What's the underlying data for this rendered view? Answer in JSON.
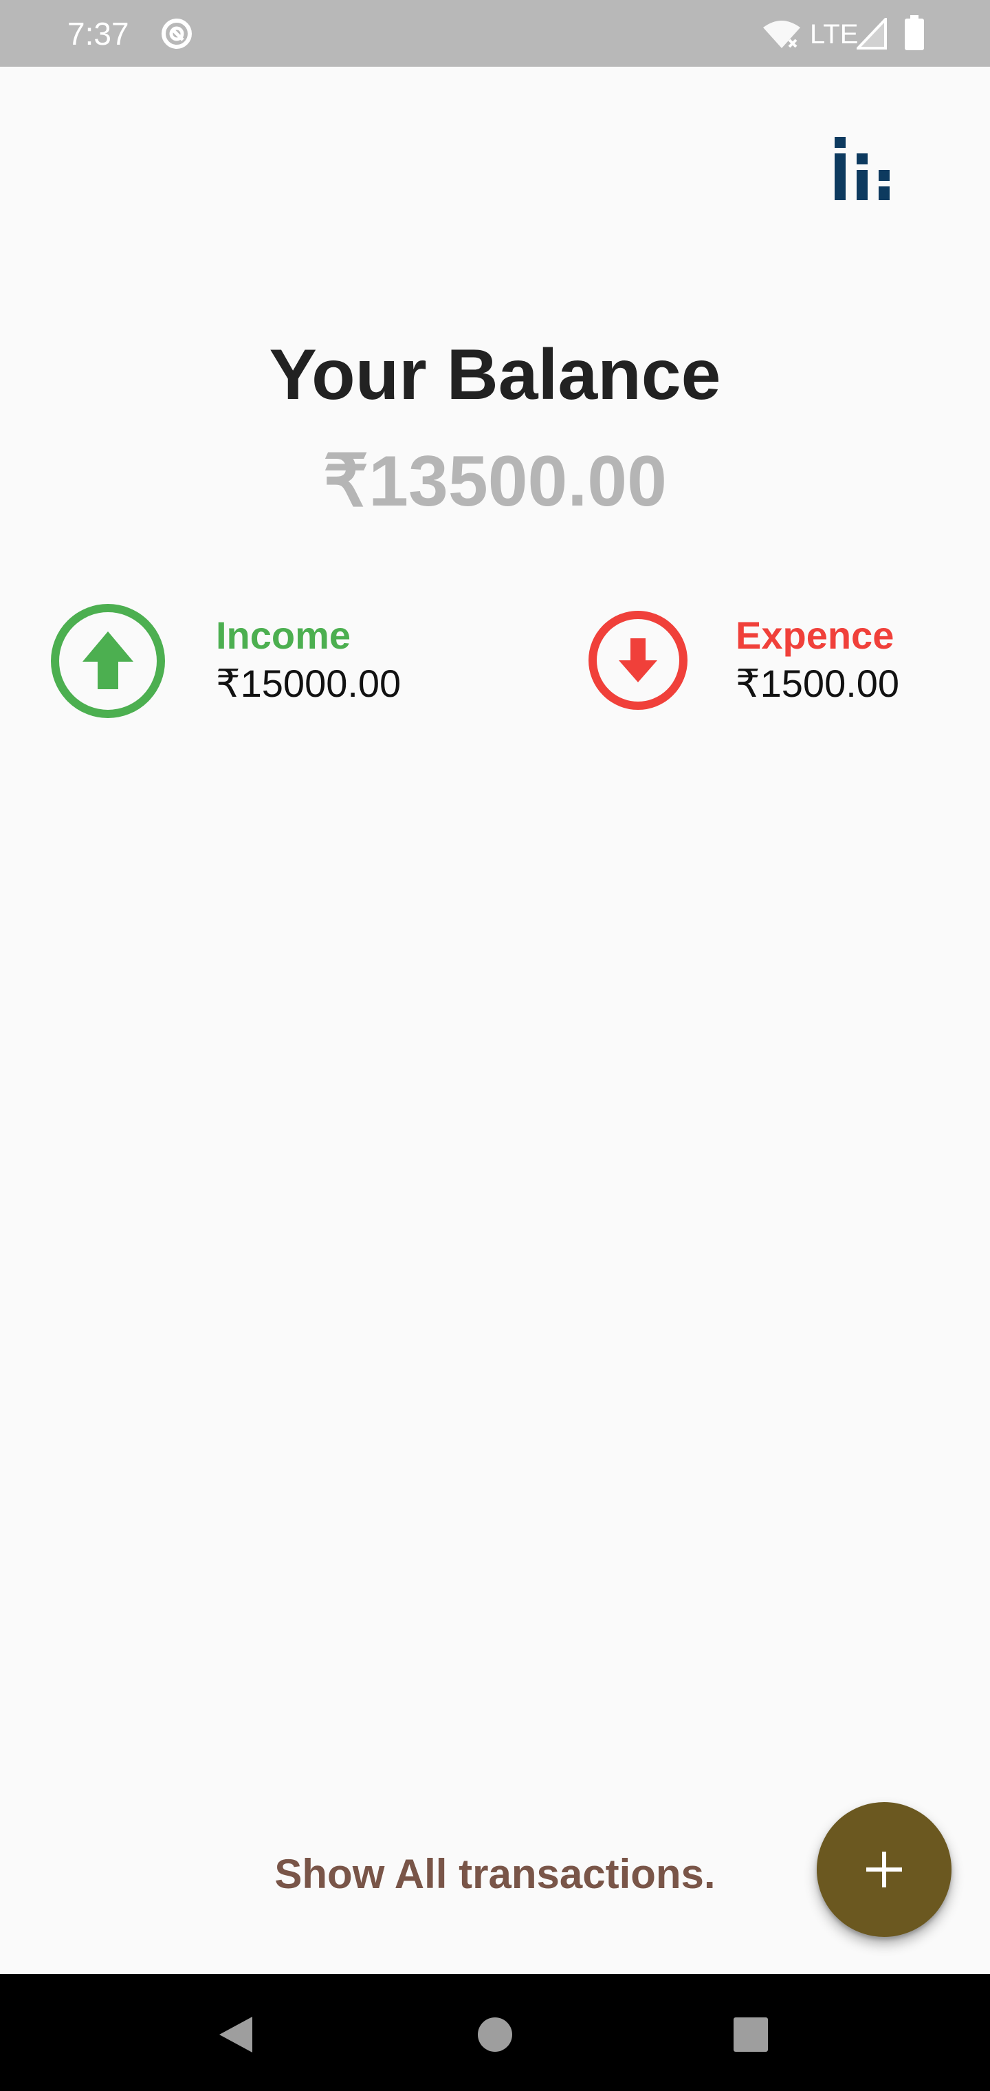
{
  "status_bar": {
    "time": "7:37",
    "network": "LTE",
    "icons": [
      "app-notification-icon",
      "wifi-off-icon",
      "signal-icon",
      "battery-icon"
    ]
  },
  "header": {
    "stats_icon": "bar-chart-icon"
  },
  "balance": {
    "title": "Your Balance",
    "amount": "₹13500.00"
  },
  "income": {
    "label": "Income",
    "value": "₹15000.00",
    "icon": "arrow-up-circle-icon",
    "color": "#4caf50"
  },
  "expence": {
    "label": "Expence",
    "value": "₹1500.00",
    "icon": "arrow-down-circle-icon",
    "color": "#f0403a"
  },
  "footer": {
    "show_all_label": "Show All transactions."
  },
  "fab": {
    "icon": "plus-icon",
    "color": "#6b5820"
  },
  "nav_bar": {
    "buttons": [
      "back-icon",
      "home-icon",
      "recents-icon"
    ]
  }
}
